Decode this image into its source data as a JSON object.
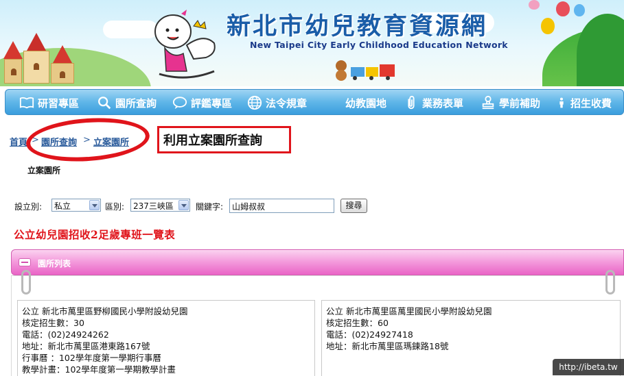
{
  "header": {
    "title_zh": "新北市幼兒教育資源網",
    "title_en": "New Taipei City Early Childhood Education Network"
  },
  "nav": {
    "items": [
      {
        "label": "研習專區",
        "icon": "book-icon"
      },
      {
        "label": "園所查詢",
        "icon": "search-icon"
      },
      {
        "label": "評鑑專區",
        "icon": "speech-bubble-icon"
      },
      {
        "label": "法令規章",
        "icon": "globe-icon"
      },
      {
        "label": "幼教園地",
        "icon": "moon-icon"
      },
      {
        "label": "業務表單",
        "icon": "paperclip-icon"
      },
      {
        "label": "學前補助",
        "icon": "stamp-icon"
      },
      {
        "label": "招生收費",
        "icon": "person-icon"
      }
    ]
  },
  "breadcrumb": {
    "home": "首頁",
    "sep1": ">",
    "search": "園所查詢",
    "sep2": ">",
    "current": "立案園所"
  },
  "callout": {
    "text": "利用立案園所查詢"
  },
  "section": {
    "subtitle": "立案園所"
  },
  "filters": {
    "type_label": "設立別:",
    "type_value": "私立",
    "district_label": "區別:",
    "district_value": "237三峽區",
    "keyword_label": "關鍵字:",
    "keyword_value": "山姆叔叔",
    "search_button": "搜尋"
  },
  "list_title": "公立幼兒園招收2足歲專班一覽表",
  "list_bar": {
    "label": "園所列表"
  },
  "cards": [
    {
      "name": "公立  新北市萬里區野柳國民小學附設幼兒園",
      "quota": "核定招生數：30",
      "phone": "電話：(02)24924262",
      "address": "地址：新北市萬里區港東路167號",
      "calendar": "行事曆    ：102學年度第一學期行事曆",
      "plan": "教學計畫：102學年度第一學期教學計畫"
    },
    {
      "name": "公立  新北市萬里區萬里國民小學附設幼兒園",
      "quota": "核定招生數：60",
      "phone": "電話：(02)24927418",
      "address": "地址：新北市萬里區瑪鍊路18號"
    }
  ],
  "watermark": "http://ibeta.tw",
  "colors": {
    "nav_blue": "#3a9ddd",
    "accent_red": "#e0141b",
    "pink_bar": "#e964c6"
  }
}
